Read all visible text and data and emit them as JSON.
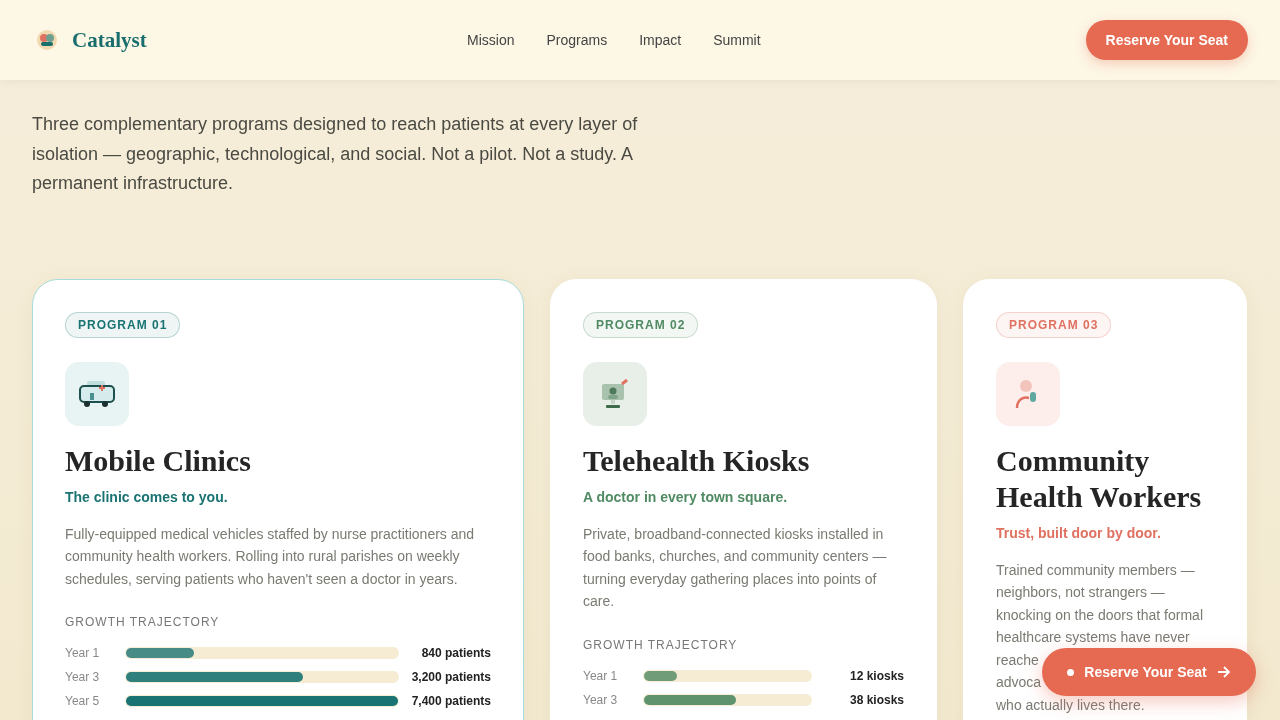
{
  "header": {
    "brand": "Catalyst",
    "nav": [
      {
        "label": "Mission"
      },
      {
        "label": "Programs"
      },
      {
        "label": "Impact"
      },
      {
        "label": "Summit"
      }
    ],
    "cta": "Reserve Your Seat"
  },
  "intro": "Three complementary programs designed to reach patients at every layer of isolation — geographic, technological, and social. Not a pilot. Not a study. A permanent infrastructure.",
  "programs": [
    {
      "badge": "PROGRAM 01",
      "kind": "clinic",
      "color": "#1a7373",
      "highlighted": true,
      "title": "Mobile Clinics",
      "tagline": "The clinic comes to you.",
      "description": "Fully-equipped medical vehicles staffed by nurse practitioners and community health workers. Rolling into rural parishes on weekly schedules, serving patients who haven't seen a doctor in years.",
      "growth_title": "GROWTH TRAJECTORY",
      "growth": [
        {
          "label": "Year 1",
          "level": 0.25,
          "reading": "840 patients"
        },
        {
          "label": "Year 3",
          "level": 0.65,
          "reading": "3,200 patients"
        },
        {
          "label": "Year 5",
          "level": 1,
          "reading": "7,400 patients"
        }
      ]
    },
    {
      "badge": "PROGRAM 02",
      "kind": "kiosk",
      "color": "#4f8a62",
      "highlighted": false,
      "title": "Telehealth Kiosks",
      "tagline": "A doctor in every town square.",
      "description": "Private, broadband-connected kiosks installed in food banks, churches, and community centers — turning everyday gathering places into points of care.",
      "growth_title": "GROWTH TRAJECTORY",
      "growth": [
        {
          "label": "Year 1",
          "level": 0.2,
          "reading": "12 kiosks"
        },
        {
          "label": "Year 3",
          "level": 0.55,
          "reading": "38 kiosks"
        }
      ]
    },
    {
      "badge": "PROGRAM 03",
      "kind": "worker",
      "color": "#e07060",
      "highlighted": false,
      "title": "Community Health Workers",
      "tagline": "Trust, built door by door.",
      "description": [
        "Trained community members —",
        "neighbors, not strangers —",
        "knocking on the doors that formal",
        "healthcare systems have never",
        "reache",
        "advoca",
        "who actually lives there."
      ]
    }
  ],
  "floating_cta": "Reserve Your Seat"
}
